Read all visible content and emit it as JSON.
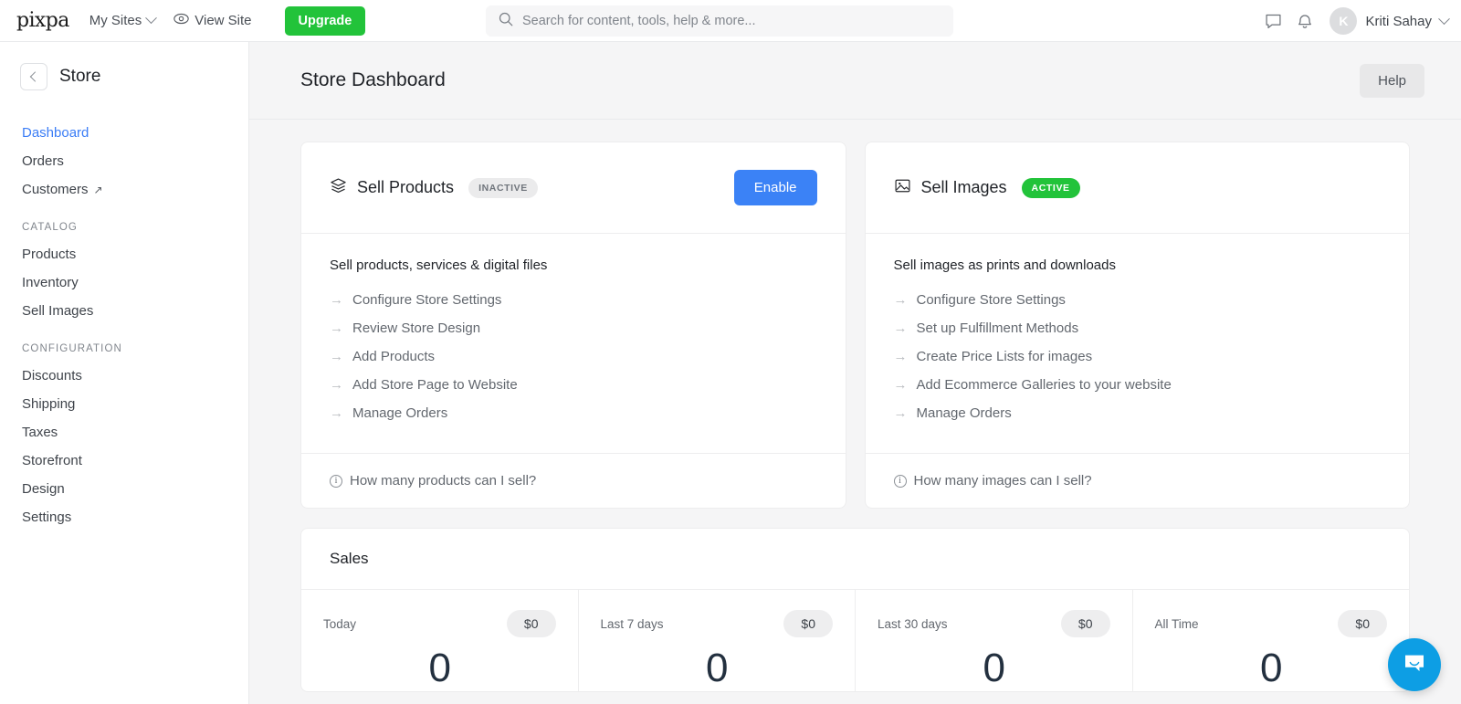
{
  "topbar": {
    "brand": "pixpa",
    "nav": [
      {
        "label": "My Sites",
        "icon": "chevron-down-icon"
      },
      {
        "label": "View Site",
        "icon": "eye-icon"
      }
    ],
    "upgrade_label": "Upgrade",
    "search": {
      "placeholder": "Search for content, tools, help & more...",
      "value": ""
    },
    "messages_icon": "chat-bubble-icon",
    "notifications_icon": "bell-icon",
    "user": {
      "initial": "K",
      "name": "Kriti Sahay"
    }
  },
  "sidebar": {
    "title": "Store",
    "back_icon": "chevron-left-icon",
    "items": [
      {
        "label": "Dashboard",
        "active": true,
        "external": false
      },
      {
        "label": "Orders",
        "active": false,
        "external": false
      },
      {
        "label": "Customers",
        "active": false,
        "external": true
      }
    ],
    "groups": [
      {
        "label": "CATALOG",
        "items": [
          {
            "label": "Products"
          },
          {
            "label": "Inventory"
          },
          {
            "label": "Sell Images"
          }
        ]
      },
      {
        "label": "CONFIGURATION",
        "items": [
          {
            "label": "Discounts"
          },
          {
            "label": "Shipping"
          },
          {
            "label": "Taxes"
          },
          {
            "label": "Storefront"
          },
          {
            "label": "Design"
          },
          {
            "label": "Settings"
          }
        ]
      }
    ]
  },
  "page": {
    "title": "Store Dashboard",
    "help_label": "Help"
  },
  "cards": [
    {
      "icon": "layers-icon",
      "title": "Sell Products",
      "status": "INACTIVE",
      "status_kind": "inactive",
      "action_label": "Enable",
      "has_action": true,
      "subtitle": "Sell products, services & digital files",
      "links": [
        "Configure Store Settings",
        "Review Store Design",
        "Add Products",
        "Add Store Page to Website",
        "Manage Orders"
      ],
      "footer": "How many products can I sell?"
    },
    {
      "icon": "image-icon",
      "title": "Sell Images",
      "status": "ACTIVE",
      "status_kind": "active",
      "action_label": "",
      "has_action": false,
      "subtitle": "Sell images as prints and downloads",
      "links": [
        "Configure Store Settings",
        "Set up Fulfillment Methods",
        "Create Price Lists for images",
        "Add Ecommerce Galleries to your website",
        "Manage Orders"
      ],
      "footer": "How many images can I sell?"
    }
  ],
  "sales": {
    "title": "Sales",
    "cells": [
      {
        "label": "Today",
        "amount": "$0",
        "count": "0"
      },
      {
        "label": "Last 7 days",
        "amount": "$0",
        "count": "0"
      },
      {
        "label": "Last 30 days",
        "amount": "$0",
        "count": "0"
      },
      {
        "label": "All Time",
        "amount": "$0",
        "count": "0"
      }
    ]
  },
  "chat": {
    "icon": "chat-smile-icon"
  },
  "colors": {
    "accent_blue": "#3b82f6",
    "accent_green": "#22c33a",
    "link_blue": "#3b7df6",
    "chat_blue": "#0d9ee4",
    "page_bg": "#f5f5f6"
  }
}
